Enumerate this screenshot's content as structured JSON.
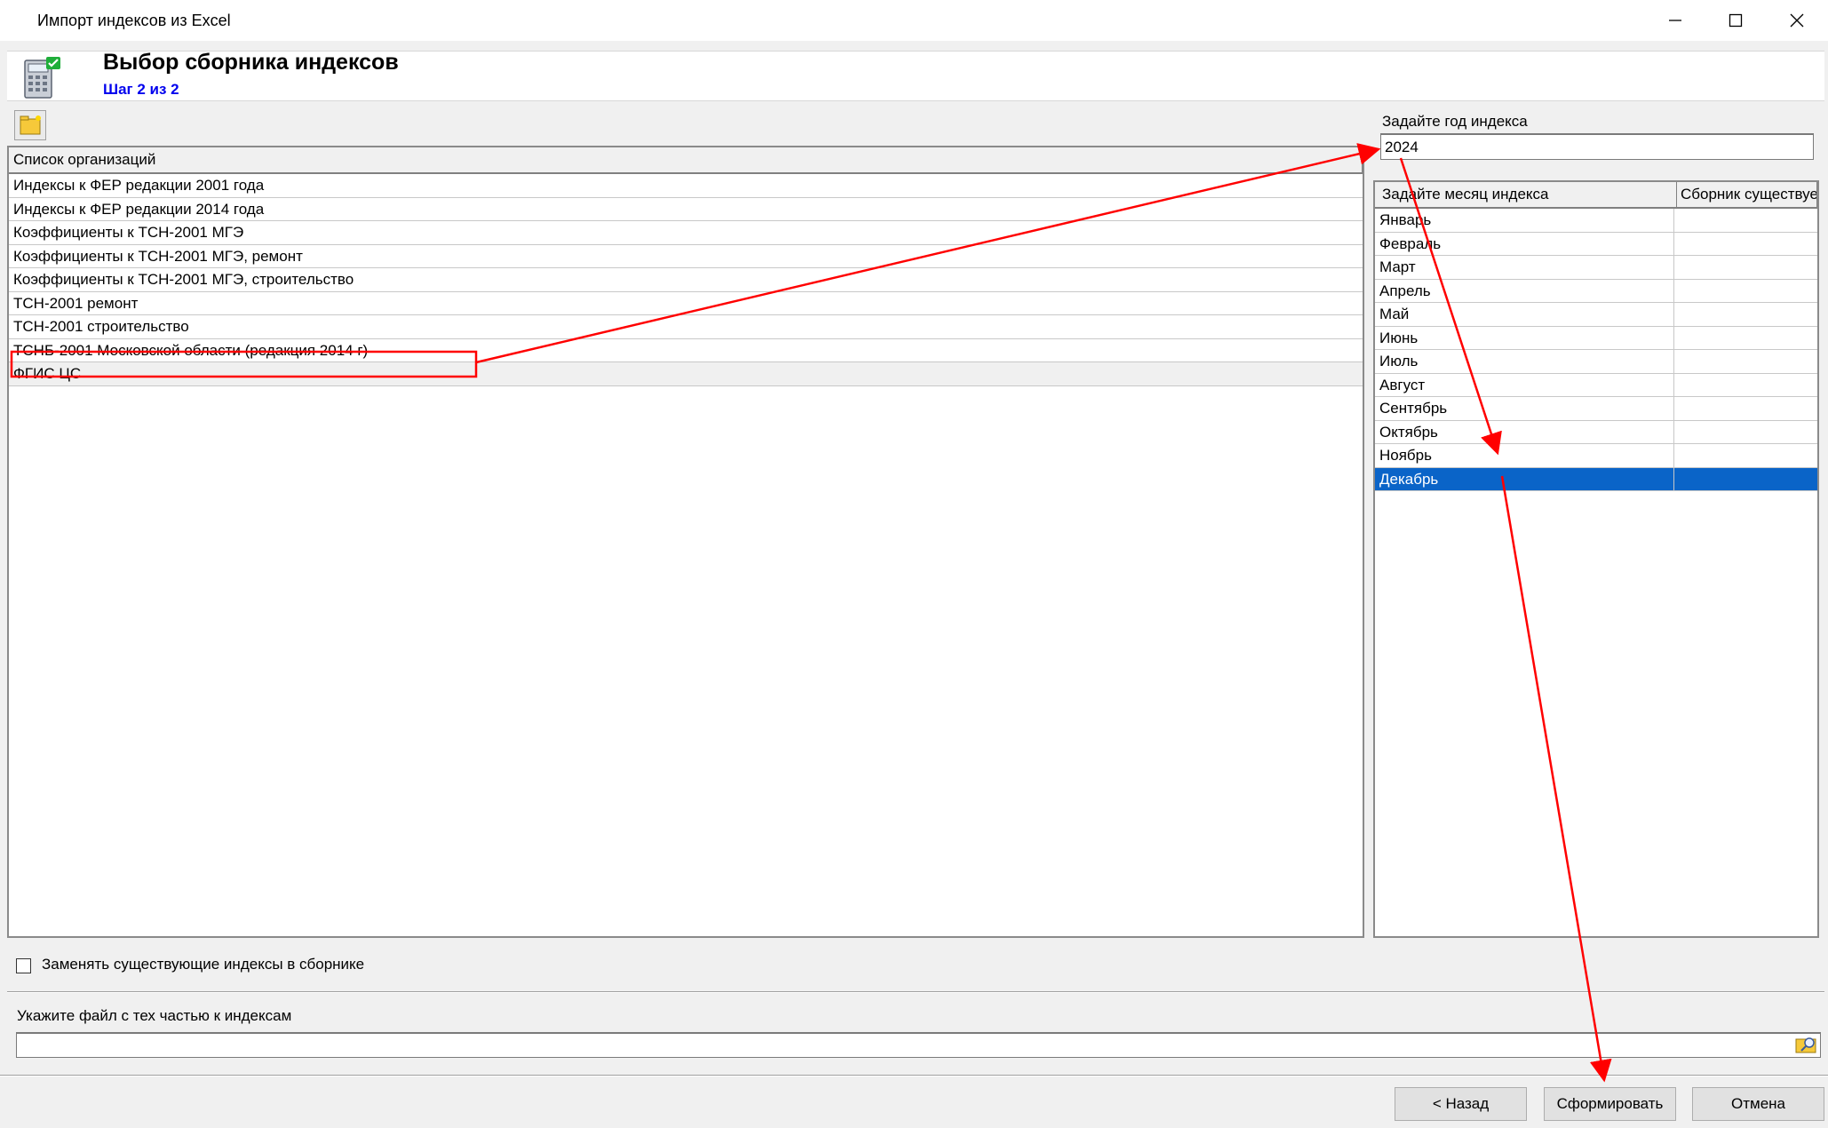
{
  "window": {
    "title": "Импорт индексов из Excel"
  },
  "header": {
    "title": "Выбор сборника индексов",
    "step": "Шаг 2 из 2"
  },
  "org_list": {
    "column_header": "Список организаций",
    "rows": [
      "Индексы к ФЕР редакции 2001 года",
      "Индексы к ФЕР редакции 2014 года",
      "Коэффициенты к ТСН-2001 МГЭ",
      "Коэффициенты к ТСН-2001 МГЭ, ремонт",
      "Коэффициенты к ТСН-2001 МГЭ, строительство",
      "ТСН-2001 ремонт",
      "ТСН-2001 строительство",
      "ТСНБ-2001 Московской области (редакция 2014 г)",
      "ФГИС ЦС"
    ],
    "selected_row": "ФГИС ЦС"
  },
  "year": {
    "label": "Задайте год индекса",
    "value": "2024"
  },
  "months": {
    "col1_header": "Задайте месяц индекса",
    "col2_header": "Сборник существует",
    "rows": [
      "Январь",
      "Февраль",
      "Март",
      "Апрель",
      "Май",
      "Июнь",
      "Июль",
      "Август",
      "Сентябрь",
      "Октябрь",
      "Ноябрь",
      "Декабрь"
    ],
    "selected": "Декабрь"
  },
  "options": {
    "replace_label": "Заменять существующие индексы в сборнике",
    "replace_checked": false
  },
  "file": {
    "label": "Укажите файл с тех частью к индексам",
    "value": ""
  },
  "buttons": {
    "back": "< Назад",
    "form": "Сформировать",
    "cancel": "Отмена"
  },
  "colors": {
    "selection": "#0a64c8",
    "annotation": "#ff0000",
    "step_text": "#0000ee"
  },
  "icons": [
    "calculator-icon",
    "folder-new-icon",
    "file-browse-icon",
    "minimize-icon",
    "maximize-icon",
    "close-icon",
    "checkbox-icon"
  ]
}
